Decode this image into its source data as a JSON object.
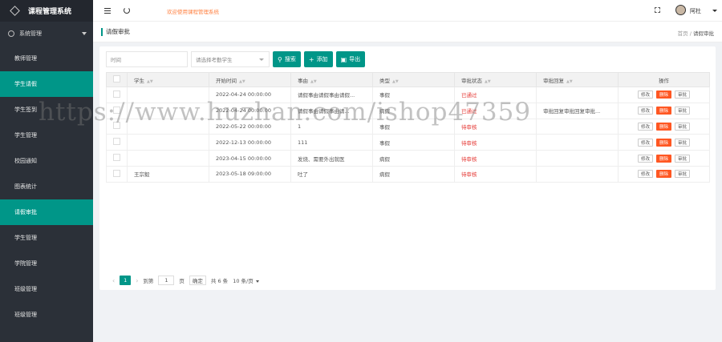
{
  "app": {
    "title": "课程管理系统"
  },
  "sidebar": {
    "group_label": "系统管理",
    "items": [
      {
        "label": "教师管理",
        "active": false
      },
      {
        "label": "学生请假",
        "active": true
      },
      {
        "label": "学生签到",
        "active": false
      },
      {
        "label": "学生管理",
        "active": false
      },
      {
        "label": "校园通知",
        "active": false
      },
      {
        "label": "图表统计",
        "active": false
      },
      {
        "label": "请假审批",
        "active": true
      },
      {
        "label": "学生管理",
        "active": false
      },
      {
        "label": "学院管理",
        "active": false
      },
      {
        "label": "班级管理",
        "active": false
      },
      {
        "label": "班级管理",
        "active": false
      }
    ]
  },
  "header": {
    "welcome": "欢迎使用课程管理系统",
    "user_name": "阿杜"
  },
  "breadcrumb": {
    "title": "请假审批",
    "home": "首页",
    "separator": "/",
    "current": "请假审批"
  },
  "search": {
    "time_placeholder": "时间",
    "student_placeholder": "请选择考勤学生",
    "search_label": "搜索",
    "add_label": "添加",
    "export_label": "导出"
  },
  "table": {
    "headers": [
      "学生",
      "开始时间",
      "事由",
      "类型",
      "审批状态",
      "审批回复",
      "操作"
    ],
    "actions": {
      "edit": "修改",
      "delete": "删除",
      "approve": "审批"
    },
    "rows": [
      {
        "student": "",
        "start": "2022-04-24 00:00:00",
        "reason": "请假事由请假事由请假...",
        "type": "事假",
        "status": "已通过",
        "reply": ""
      },
      {
        "student": "",
        "start": "2022-04-24 00:00:00",
        "reason": "请假事由请假事由请...",
        "type": "病假",
        "status": "已通过",
        "reply": "审批回复审批回复审批..."
      },
      {
        "student": "",
        "start": "2022-05-22 00:00:00",
        "reason": "1",
        "type": "事假",
        "status": "待审核",
        "reply": ""
      },
      {
        "student": "",
        "start": "2022-12-13 00:00:00",
        "reason": "111",
        "type": "事假",
        "status": "待审核",
        "reply": ""
      },
      {
        "student": "",
        "start": "2023-04-15 00:00:00",
        "reason": "发烧、需要外出就医",
        "type": "病假",
        "status": "待审核",
        "reply": ""
      },
      {
        "student": "王宗毅",
        "start": "2023-05-18 09:00:00",
        "reason": "吐了",
        "type": "病假",
        "status": "待审核",
        "reply": ""
      }
    ]
  },
  "pagination": {
    "current_page": "1",
    "goto_label": "到第",
    "goto_value": "1",
    "page_unit": "页",
    "confirm_label": "确定",
    "total_label": "共 6 条",
    "page_size_label": "10 条/页"
  },
  "watermark": "https://www.huzhan.com/ishop47359"
}
